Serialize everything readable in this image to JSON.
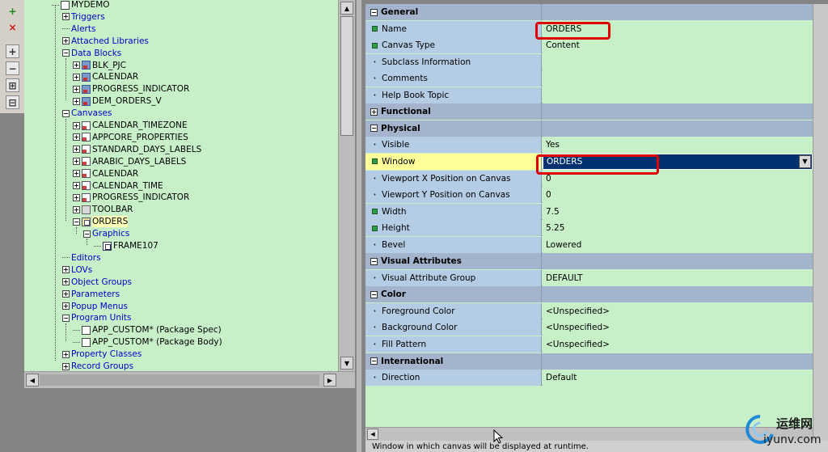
{
  "left_toolbar": {
    "buttons": [
      {
        "name": "create-button",
        "glyph": "+",
        "color": "#1a8a1a"
      },
      {
        "name": "delete-button",
        "glyph": "×",
        "color": "#c81414"
      },
      {
        "name": "expand-button",
        "glyph": "+"
      },
      {
        "name": "collapse-button",
        "glyph": "−"
      },
      {
        "name": "expand-all-button",
        "glyph": "⊞"
      },
      {
        "name": "collapse-all-button",
        "glyph": "⊟"
      }
    ]
  },
  "navigator": {
    "items": [
      {
        "label": "MYDEMO",
        "exp": "",
        "icon": "form-module-icon",
        "blue": false
      },
      {
        "label": "Triggers",
        "exp": "+",
        "icon": "",
        "blue": true
      },
      {
        "label": "Alerts",
        "exp": "",
        "icon": "",
        "blue": true
      },
      {
        "label": "Attached Libraries",
        "exp": "+",
        "icon": "",
        "blue": true
      },
      {
        "label": "Data Blocks",
        "exp": "−",
        "icon": "",
        "blue": true
      },
      {
        "label": "BLK_PJC",
        "exp": "+",
        "icon": "data-block-icon",
        "blue": false
      },
      {
        "label": "CALENDAR",
        "exp": "+",
        "icon": "data-block-icon",
        "blue": false
      },
      {
        "label": "PROGRESS_INDICATOR",
        "exp": "+",
        "icon": "data-block-icon",
        "blue": false
      },
      {
        "label": "DEM_ORDERS_V",
        "exp": "+",
        "icon": "data-block-icon",
        "blue": false
      },
      {
        "label": "Canvases",
        "exp": "−",
        "icon": "",
        "blue": true
      },
      {
        "label": "CALENDAR_TIMEZONE",
        "exp": "+",
        "icon": "canvas-icon",
        "blue": false
      },
      {
        "label": "APPCORE_PROPERTIES",
        "exp": "+",
        "icon": "canvas-icon",
        "blue": false
      },
      {
        "label": "STANDARD_DAYS_LABELS",
        "exp": "+",
        "icon": "canvas-icon",
        "blue": false
      },
      {
        "label": "ARABIC_DAYS_LABELS",
        "exp": "+",
        "icon": "canvas-icon",
        "blue": false
      },
      {
        "label": "CALENDAR",
        "exp": "+",
        "icon": "canvas-icon",
        "blue": false
      },
      {
        "label": "CALENDAR_TIME",
        "exp": "+",
        "icon": "canvas-icon",
        "blue": false
      },
      {
        "label": "PROGRESS_INDICATOR",
        "exp": "+",
        "icon": "canvas-icon",
        "blue": false
      },
      {
        "label": "TOOLBAR",
        "exp": "+",
        "icon": "toolbar-canvas-icon",
        "blue": false
      },
      {
        "label": "ORDERS",
        "exp": "−",
        "icon": "selected-canvas-icon",
        "blue": false,
        "selected": true
      },
      {
        "label": "Graphics",
        "exp": "−",
        "icon": "",
        "blue": true
      },
      {
        "label": "FRAME107",
        "exp": "",
        "icon": "frame-icon",
        "blue": false
      },
      {
        "label": "Editors",
        "exp": "",
        "icon": "",
        "blue": true
      },
      {
        "label": "LOVs",
        "exp": "+",
        "icon": "",
        "blue": true
      },
      {
        "label": "Object Groups",
        "exp": "+",
        "icon": "",
        "blue": true
      },
      {
        "label": "Parameters",
        "exp": "+",
        "icon": "",
        "blue": true
      },
      {
        "label": "Popup Menus",
        "exp": "+",
        "icon": "",
        "blue": true
      },
      {
        "label": "Program Units",
        "exp": "−",
        "icon": "",
        "blue": true
      },
      {
        "label": "APP_CUSTOM* (Package Spec)",
        "exp": "",
        "icon": "package-spec-icon",
        "blue": false
      },
      {
        "label": "APP_CUSTOM* (Package Body)",
        "exp": "",
        "icon": "package-body-icon",
        "blue": false
      },
      {
        "label": "Property Classes",
        "exp": "+",
        "icon": "",
        "blue": true
      },
      {
        "label": "Record Groups",
        "exp": "+",
        "icon": "",
        "blue": true
      }
    ]
  },
  "palette": {
    "rows": [
      {
        "type": "section",
        "name": "General",
        "state": "−"
      },
      {
        "type": "prop",
        "name": "Name",
        "value": "ORDERS",
        "bullet": "green"
      },
      {
        "type": "prop",
        "name": "Canvas Type",
        "value": "Content",
        "bullet": "green"
      },
      {
        "type": "prop",
        "name": "Subclass Information",
        "value": "",
        "bullet": "dot"
      },
      {
        "type": "prop",
        "name": "Comments",
        "value": "",
        "bullet": "dot"
      },
      {
        "type": "prop",
        "name": "Help Book Topic",
        "value": "",
        "bullet": "dot"
      },
      {
        "type": "section",
        "name": "Functional",
        "state": "+"
      },
      {
        "type": "section",
        "name": "Physical",
        "state": "−"
      },
      {
        "type": "prop",
        "name": "Visible",
        "value": "Yes",
        "bullet": "dot"
      },
      {
        "type": "prop",
        "name": "Window",
        "value": "ORDERS",
        "bullet": "green",
        "current": true,
        "dropdown": true
      },
      {
        "type": "prop",
        "name": "Viewport X Position on Canvas",
        "value": "0",
        "bullet": "dot"
      },
      {
        "type": "prop",
        "name": "Viewport Y Position on Canvas",
        "value": "0",
        "bullet": "dot"
      },
      {
        "type": "prop",
        "name": "Width",
        "value": "7.5",
        "bullet": "green"
      },
      {
        "type": "prop",
        "name": "Height",
        "value": "5.25",
        "bullet": "green"
      },
      {
        "type": "prop",
        "name": "Bevel",
        "value": "Lowered",
        "bullet": "dot"
      },
      {
        "type": "section",
        "name": "Visual Attributes",
        "state": "−"
      },
      {
        "type": "prop",
        "name": "Visual Attribute Group",
        "value": "DEFAULT",
        "bullet": "dot"
      },
      {
        "type": "section",
        "name": "Color",
        "state": "−"
      },
      {
        "type": "prop",
        "name": "Foreground Color",
        "value": "<Unspecified>",
        "bullet": "dot"
      },
      {
        "type": "prop",
        "name": "Background Color",
        "value": "<Unspecified>",
        "bullet": "dot"
      },
      {
        "type": "prop",
        "name": "Fill Pattern",
        "value": "<Unspecified>",
        "bullet": "dot"
      },
      {
        "type": "section",
        "name": "International",
        "state": "−"
      },
      {
        "type": "prop",
        "name": "Direction",
        "value": "Default",
        "bullet": "dot"
      }
    ],
    "status_text": "Window in which canvas will be displayed at runtime."
  },
  "watermark": {
    "cn": "运维网",
    "url": "iyunv.com"
  },
  "colors": {
    "highlight": "#e00000",
    "dropdown_bg": "#003070"
  }
}
